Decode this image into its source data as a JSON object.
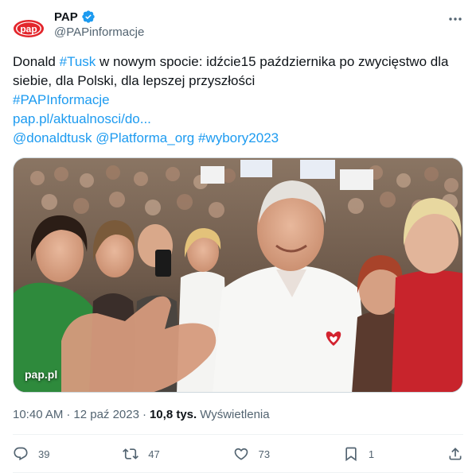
{
  "account": {
    "display_name": "PAP",
    "handle": "@PAPinformacje",
    "logo_text": "pap",
    "verified_icon": "verified-badge-icon"
  },
  "tweet": {
    "line1_pre": "Donald ",
    "line1_tag": "#Tusk",
    "line1_post": " w nowym spocie: idźcie15 października po zwycięstwo dla",
    "line2": "siebie, dla Polski, dla lepszej przyszłości",
    "hashtag_pap": "#PAPInformacje",
    "url": "pap.pl/aktualnosci/do...",
    "mention_tusk": "@donaldtusk",
    "mention_po": "@Platforma_org",
    "hashtag_wybory": "#wybory2023"
  },
  "media": {
    "source_label": "pap.pl"
  },
  "meta": {
    "time": "10:40 AM",
    "dot1": "·",
    "date": "12 paź 2023",
    "dot2": "·",
    "views_count": "10,8 tys.",
    "views_label": "Wyświetlenia"
  },
  "actions": {
    "replies": "39",
    "reposts": "47",
    "likes": "73",
    "bookmarks": "1"
  },
  "colors": {
    "accent": "#1d9bf0",
    "text": "#0f1419",
    "secondary": "#536471",
    "pap_red": "#e3262c"
  }
}
